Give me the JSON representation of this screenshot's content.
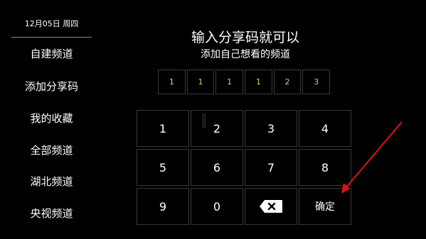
{
  "sidebar": {
    "date": "12月05日 周四",
    "items": [
      {
        "label": "自建频道"
      },
      {
        "label": "添加分享码"
      },
      {
        "label": "我的收藏"
      },
      {
        "label": "全部频道"
      },
      {
        "label": "湖北频道"
      },
      {
        "label": "央视频道"
      }
    ]
  },
  "main": {
    "title": "输入分享码就可以",
    "subtitle": "添加自己想看的频道",
    "code_digits": [
      "1",
      "1",
      "1",
      "1",
      "2",
      "3"
    ],
    "keypad": {
      "keys": [
        "1",
        "2",
        "3",
        "4",
        "5",
        "6",
        "7",
        "8",
        "9",
        "0"
      ],
      "backspace_icon": "backspace-icon",
      "confirm_label": "确定"
    }
  },
  "colors": {
    "background": "#000000",
    "code_digit": "#d7d05a",
    "arrow": "#e01010"
  }
}
